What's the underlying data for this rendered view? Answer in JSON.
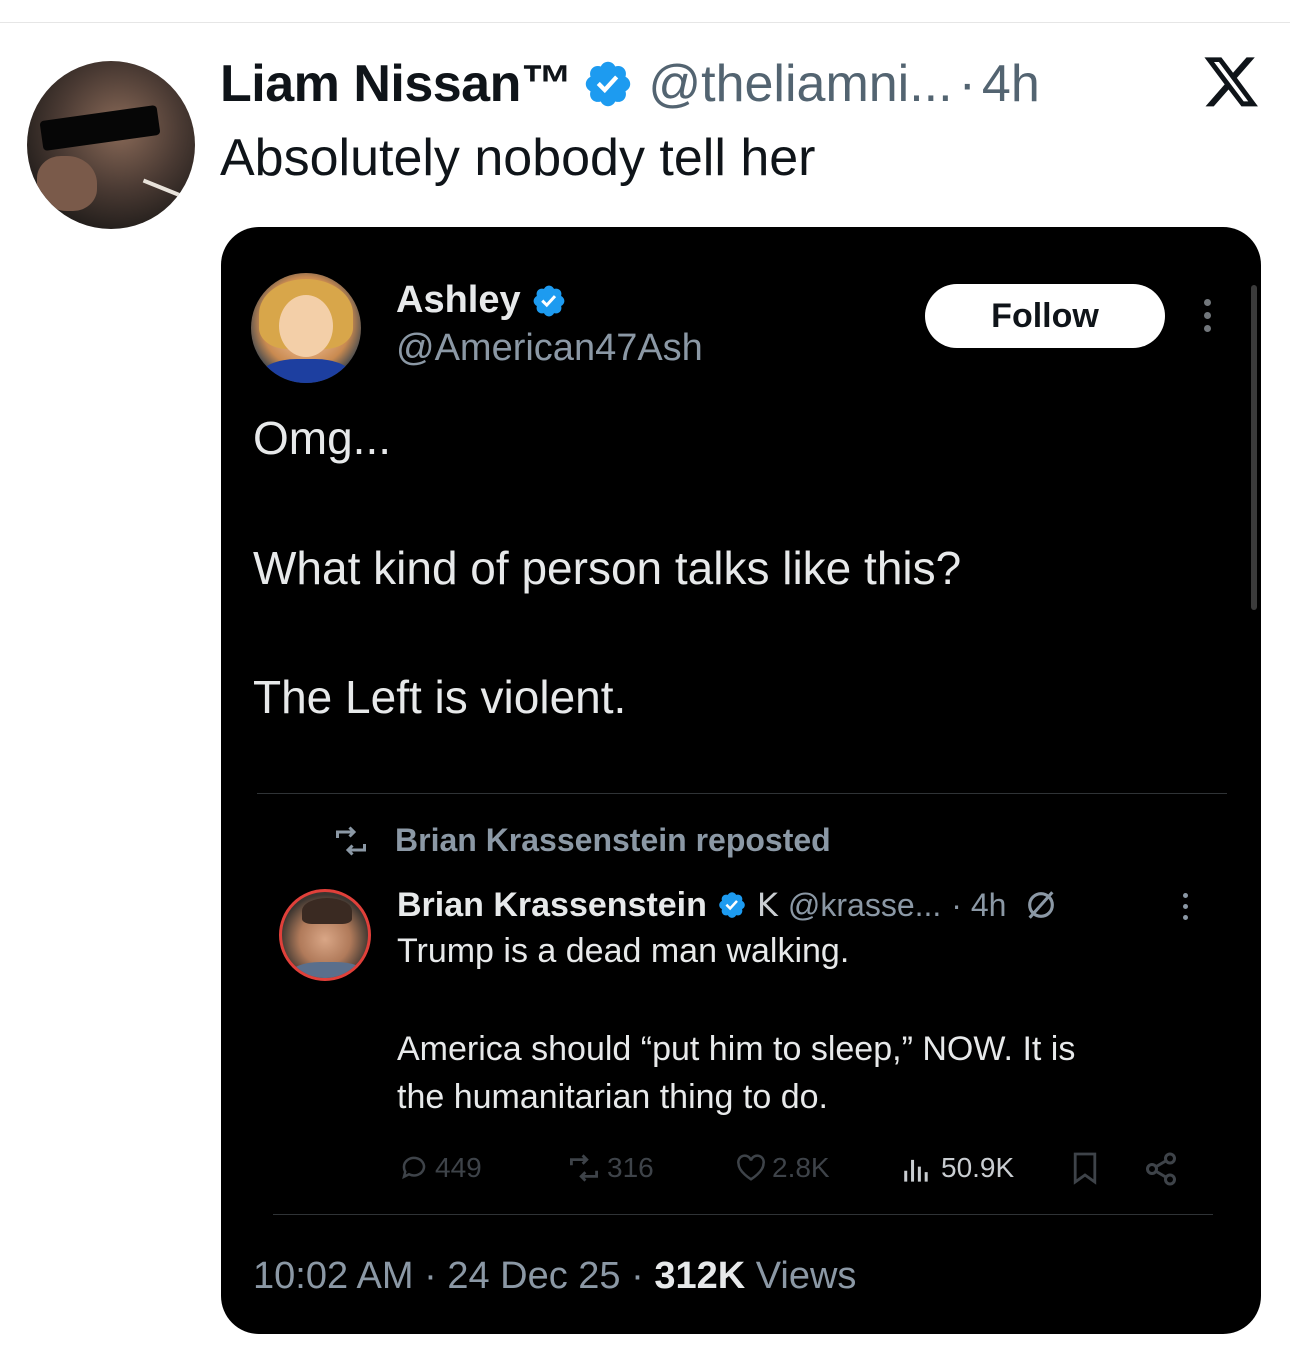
{
  "outer": {
    "name": "Liam Nissan™",
    "handle": "@theliamni...",
    "dot": "·",
    "time": "4h",
    "text": "Absolutely nobody tell her"
  },
  "card": {
    "author_name": "Ashley",
    "author_handle": "@American47Ash",
    "follow_label": "Follow",
    "lines": [
      "Omg...",
      "What kind of person talks like this?",
      "The Left is violent."
    ],
    "timestamp": "10:02 AM · 24 Dec 25 · ",
    "views_count": "312K",
    "views_label": " Views"
  },
  "embedded": {
    "repost_label": "Brian Krassenstein reposted",
    "name": "Brian Krassenstein",
    "k_glyph": "K",
    "handle": "@krasse...",
    "time": "· 4h",
    "lines": [
      "Trump is a dead man walking.",
      "America should “put him to sleep,” NOW.  It is",
      "the humanitarian thing to do."
    ],
    "replies": "449",
    "reposts": "316",
    "likes": "2.8K",
    "views": "50.9K"
  },
  "colors": {
    "verified_blue": "#1d9bf0",
    "card_bg": "#000000",
    "muted": "#8b98a5"
  },
  "icons": [
    "x-logo-icon",
    "verified-badge-icon",
    "more-options-icon",
    "repost-icon",
    "reply-icon",
    "like-icon",
    "views-icon",
    "bookmark-icon",
    "share-icon",
    "no-edit-icon"
  ]
}
